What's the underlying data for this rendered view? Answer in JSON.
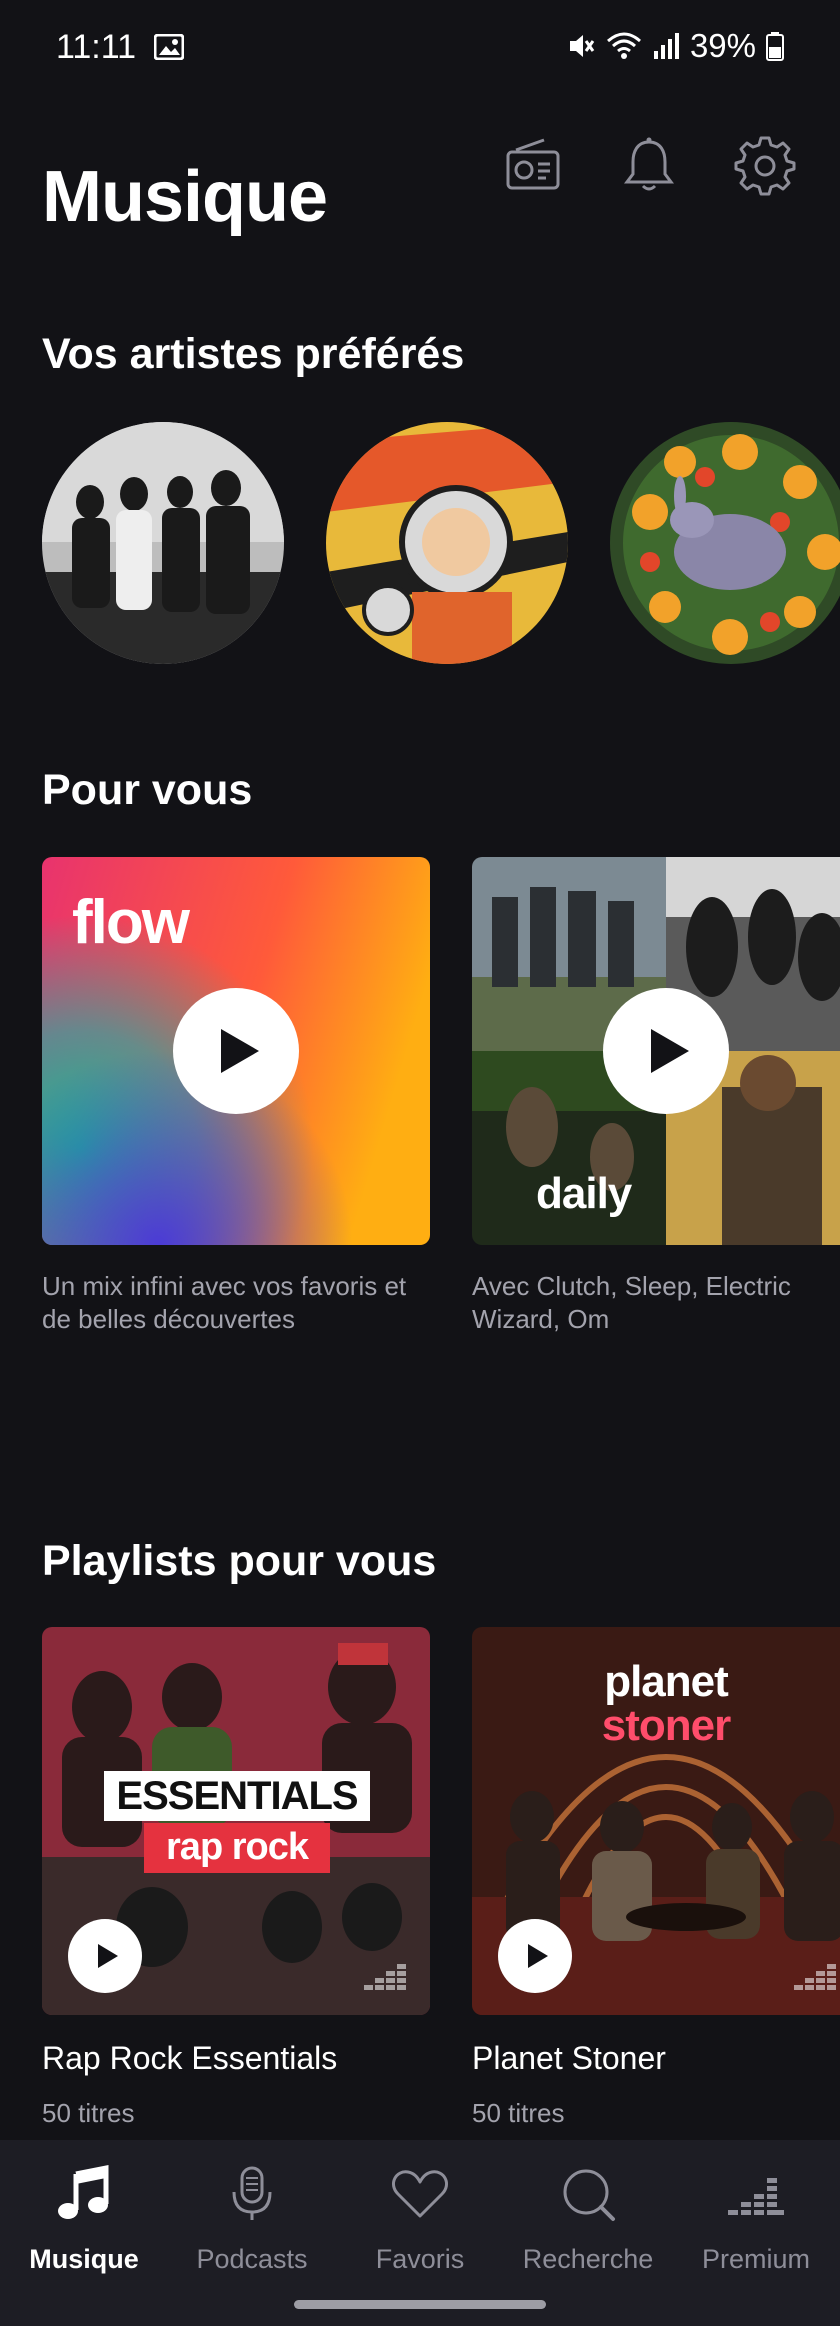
{
  "status_bar": {
    "time": "11:11",
    "battery": "39%"
  },
  "header": {
    "title": "Musique",
    "icons": [
      "radio-icon",
      "bell-icon",
      "gear-icon"
    ]
  },
  "favorite_artists": {
    "title": "Vos artistes préférés",
    "count_visible": 3
  },
  "for_you": {
    "title": "Pour vous",
    "cards": [
      {
        "label": "flow",
        "description": "Un mix infini avec vos favoris et de belles découvertes"
      },
      {
        "label": "daily",
        "description": "Avec Clutch, Sleep, Electric Wizard, Om"
      }
    ]
  },
  "playlists": {
    "title": "Playlists pour vous",
    "items": [
      {
        "cover_line1": "ESSENTIALS",
        "cover_line2": "rap rock",
        "title": "Rap Rock Essentials",
        "count": "50 titres"
      },
      {
        "cover_line1": "planet",
        "cover_line2": "stoner",
        "title": "Planet Stoner",
        "count": "50 titres"
      }
    ]
  },
  "bottom_nav": {
    "items": [
      {
        "label": "Musique",
        "icon": "music-note-icon",
        "active": true
      },
      {
        "label": "Podcasts",
        "icon": "microphone-icon",
        "active": false
      },
      {
        "label": "Favoris",
        "icon": "heart-icon",
        "active": false
      },
      {
        "label": "Recherche",
        "icon": "search-icon",
        "active": false
      },
      {
        "label": "Premium",
        "icon": "equalizer-icon",
        "active": false
      }
    ]
  },
  "colors": {
    "background": "#121216",
    "nav_background": "#1d1d24",
    "muted_text": "#a3a3ad",
    "accent_red": "#e5323f"
  }
}
